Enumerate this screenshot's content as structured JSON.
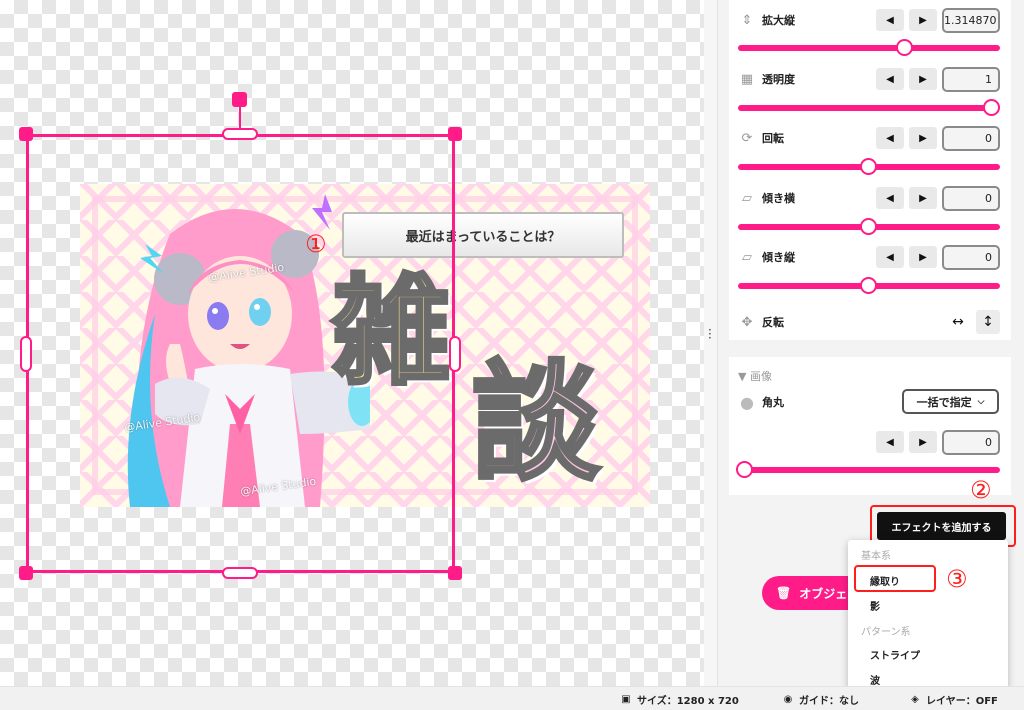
{
  "artwork": {
    "question_text": "最近はまっていることは？",
    "big_char_1": "雑",
    "big_char_2": "談",
    "watermark": "@Alive Studio"
  },
  "annotations": {
    "marker_1": "①",
    "marker_2": "②",
    "marker_3": "③"
  },
  "properties": {
    "scale_y": {
      "label": "拡大縦",
      "value": "1.314870",
      "icon": "resize-vertical-icon"
    },
    "opacity": {
      "label": "透明度",
      "value": "1",
      "icon": "transparency-icon"
    },
    "rotation": {
      "label": "回転",
      "value": "0",
      "icon": "rotate-icon"
    },
    "skew_x": {
      "label": "傾き横",
      "value": "0",
      "icon": "skew-horizontal-icon"
    },
    "skew_y": {
      "label": "傾き縦",
      "value": "0",
      "icon": "skew-vertical-icon"
    },
    "flip": {
      "label": "反転",
      "icon": "move-icon"
    }
  },
  "image_section": {
    "title": "▼ 画像",
    "corner_label": "角丸",
    "corner_mode": "一括で指定",
    "corner_value": "0"
  },
  "effects": {
    "add_button": "エフェクトを追加する",
    "object_button": "オブジェク",
    "menu": {
      "group_basic": "基本系",
      "item_outline": "縁取り",
      "item_shadow": "影",
      "group_pattern": "パターン系",
      "item_stripe": "ストライプ",
      "item_wave": "波"
    }
  },
  "status": {
    "size": "サイズ：1280 x 720",
    "guide": "ガイド：なし",
    "layer": "レイヤー：OFF"
  },
  "colors": {
    "accent": "#ff1c88",
    "annotation": "#ff1e1e"
  }
}
